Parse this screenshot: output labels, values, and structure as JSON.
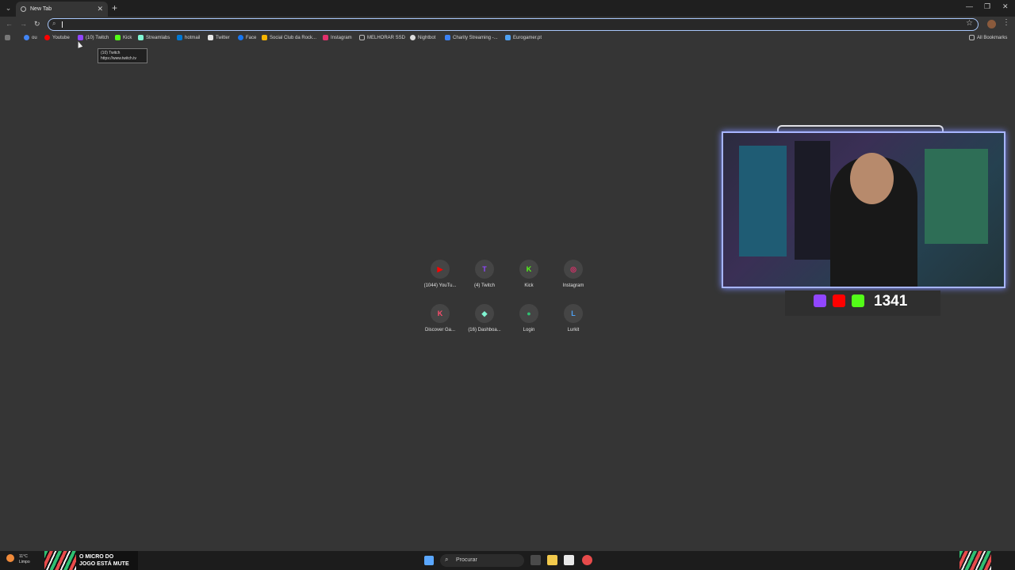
{
  "browser": {
    "tab": {
      "title": "New Tab"
    },
    "omnibox": {
      "placeholder": ""
    },
    "bookmarks": [
      {
        "label": "ou",
        "color": "#4285f4"
      },
      {
        "label": "Youtube",
        "color": "#ff0000"
      },
      {
        "label": "(10) Twitch",
        "color": "#9146ff"
      },
      {
        "label": "Kick",
        "color": "#53fc18"
      },
      {
        "label": "Streamlabs",
        "color": "#80f5d2"
      },
      {
        "label": "hotmail",
        "color": "#0078d4"
      },
      {
        "label": "Twitter",
        "color": "#ffffff"
      },
      {
        "label": "Face",
        "color": "#1877f2"
      },
      {
        "label": "Social Club da Rock...",
        "color": "#f5b400"
      },
      {
        "label": "Instagram",
        "color": "#e1306c"
      },
      {
        "label": "MELHORAR SSD",
        "color": "#bbbbbb"
      },
      {
        "label": "Nightbot",
        "color": "#dddddd"
      },
      {
        "label": "Charity Streaming -...",
        "color": "#3b82f6"
      },
      {
        "label": "Eurogamer.pt",
        "color": "#4ea1f3"
      }
    ],
    "all_bookmarks": "All Bookmarks",
    "tooltip": {
      "title": "(10) Twitch",
      "url": "https://www.twitch.tv"
    }
  },
  "shortcuts": [
    {
      "label": "(1044) YouTu...",
      "icon": "youtube-icon",
      "color": "#ff0000",
      "glyph": "▶"
    },
    {
      "label": "(4) Twitch",
      "icon": "twitch-icon",
      "color": "#9146ff",
      "glyph": "T"
    },
    {
      "label": "Kick",
      "icon": "kick-icon",
      "color": "#53fc18",
      "glyph": "K"
    },
    {
      "label": "Instagram",
      "icon": "instagram-icon",
      "color": "#e1306c",
      "glyph": "◎"
    },
    {
      "label": "Discover Ga...",
      "icon": "discover-icon",
      "color": "#ff4d6d",
      "glyph": "K"
    },
    {
      "label": "(16) Dashboa...",
      "icon": "dashboard-icon",
      "color": "#80f5d2",
      "glyph": "◆"
    },
    {
      "label": "Login",
      "icon": "login-icon",
      "color": "#2fbf71",
      "glyph": "●"
    },
    {
      "label": "Lurkit",
      "icon": "lurkit-icon",
      "color": "#4ea1f3",
      "glyph": "L"
    }
  ],
  "overlay": {
    "count": "1341"
  },
  "taskbar": {
    "weather_temp": "11°C",
    "weather_desc": "Limpo",
    "banner_line1": "O MICRO DO",
    "banner_line2": "JOGO ESTÁ MUTE",
    "search_placeholder": "Procurar"
  }
}
